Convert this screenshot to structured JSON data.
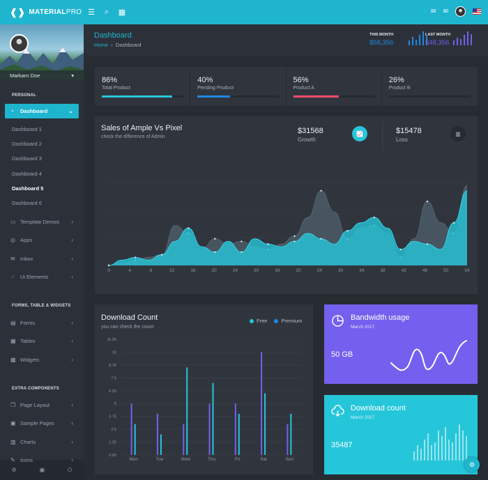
{
  "app": {
    "brand_bold": "MATERIAL",
    "brand_light": "PRO"
  },
  "topbar": {
    "menu_icon": "hamburger-icon",
    "search_icon": "search-icon",
    "grid_icon": "grid-icon",
    "right_icons": [
      "message-icon",
      "mail-icon",
      "user-avatar",
      "us-flag-icon"
    ]
  },
  "sidebar": {
    "user_name": "Markarn Doe",
    "sections": {
      "personal": "PERSONAL",
      "forms": "FORMS, TABLE & WIDGETS",
      "extra": "EXTRA COMPONENTS"
    },
    "dashboard": {
      "label": "Dashboard",
      "icon": "gauge-icon"
    },
    "dashboard_items": [
      "Dashboard 1",
      "Dashboard 2",
      "Dashboard 3",
      "Dashboard 4",
      "Dashboard 5",
      "Dashboard 6"
    ],
    "current_dashboard": "Dashboard 5",
    "menu": [
      {
        "label": "Template Demos",
        "icon": "laptop-icon"
      },
      {
        "label": "Apps",
        "icon": "target-icon"
      },
      {
        "label": "Inbox",
        "icon": "envelope-icon"
      },
      {
        "label": "Ui Elements",
        "icon": "bubbles-icon"
      }
    ],
    "forms_menu": [
      {
        "label": "Forms",
        "icon": "file-icon"
      },
      {
        "label": "Tables",
        "icon": "table-icon"
      },
      {
        "label": "Widgets",
        "icon": "widgets-icon"
      }
    ],
    "extra_menu": [
      {
        "label": "Page Layout",
        "icon": "copy-icon"
      },
      {
        "label": "Sample Pages",
        "icon": "pages-icon"
      },
      {
        "label": "Charts",
        "icon": "file-chart-icon"
      },
      {
        "label": "Icons",
        "icon": "brush-icon"
      }
    ],
    "footer_icons": [
      "settings-icon",
      "inbox-icon",
      "power-icon"
    ]
  },
  "header": {
    "title": "Dashboard",
    "breadcrumb_home": "Home",
    "breadcrumb_current": "Dashboard",
    "this_month": {
      "label": "THIS MONTH",
      "value": "$58,356",
      "bars": [
        4,
        7,
        5,
        9,
        12,
        8
      ]
    },
    "last_month": {
      "label": "LAST MONTH",
      "value": "$48,356",
      "bars": [
        4,
        6,
        5,
        8,
        11,
        9
      ]
    }
  },
  "kpis": [
    {
      "value": "86%",
      "label": "Total Product",
      "percent": 86,
      "color": "#26c6da"
    },
    {
      "value": "40%",
      "label": "Pending Product",
      "percent": 40,
      "color": "#1e88e5"
    },
    {
      "value": "56%",
      "label": "Product A",
      "percent": 56,
      "color": "#fc4b6c"
    },
    {
      "value": "26%",
      "label": "Product B",
      "percent": 0,
      "color": "#7460ee"
    }
  ],
  "sales_chart": {
    "title": "Sales of Ample Vs Pixel",
    "subtitle": "check the difference of Admin",
    "growth_value": "$31568",
    "growth_label": "Growth",
    "growth_icon": "line-chart-icon",
    "loss_value": "$15478",
    "loss_label": "Loss",
    "loss_icon": "bar-chart-icon"
  },
  "download_count": {
    "title": "Download Count",
    "subtitle": "you can check the count",
    "legend_free": "Free",
    "legend_premium": "Premium"
  },
  "bandwidth": {
    "title": "Bandwidth usage",
    "date": "March 2017",
    "value": "50 GB",
    "icon": "pie-chart-icon"
  },
  "download_widget": {
    "title": "Download count",
    "date": "March 2017",
    "value": "35487",
    "icon": "cloud-download-icon",
    "bars": [
      3,
      5,
      4,
      7,
      9,
      5,
      6,
      10,
      8,
      11,
      7,
      6,
      9,
      12,
      10,
      8
    ]
  },
  "fab_icon": "gear-icon",
  "chart_data": [
    {
      "type": "area",
      "x": [
        0,
        2,
        4,
        6,
        8,
        10,
        12,
        14,
        16,
        18,
        20,
        22,
        24,
        26,
        28,
        30,
        32,
        34,
        36,
        38,
        40,
        42,
        44,
        46,
        48,
        50,
        52,
        54
      ],
      "x_ticks": [
        0,
        4,
        8,
        12,
        16,
        20,
        24,
        30,
        16,
        20,
        24,
        30,
        34,
        38,
        42,
        46,
        50,
        54
      ],
      "series": [
        {
          "color": "#4a5a66",
          "values": [
            0,
            1,
            2,
            3,
            4,
            15,
            12,
            6,
            10,
            8,
            9,
            7,
            6,
            8,
            11,
            18,
            28,
            20,
            10,
            14,
            15,
            12,
            3,
            10,
            24,
            16,
            12,
            30
          ]
        },
        {
          "color": "#26c6da",
          "values": [
            0,
            2,
            3,
            2,
            4,
            9,
            14,
            7,
            5,
            9,
            5,
            10,
            8,
            7,
            9,
            12,
            10,
            8,
            13,
            16,
            18,
            14,
            6,
            9,
            8,
            6,
            16,
            28
          ]
        }
      ],
      "ylim": [
        0,
        35
      ]
    },
    {
      "type": "bar",
      "categories": [
        "Mon",
        "Tue",
        "Wed",
        "Thu",
        "Fri",
        "Sat",
        "Sun"
      ],
      "y_ticks": [
        "0.00",
        "1.25",
        "2.5",
        "3.75",
        "5",
        "6.25",
        "7.5",
        "8.75",
        "10",
        "11.25"
      ],
      "ylim": [
        0,
        11.25
      ],
      "series": [
        {
          "name": "Free",
          "color": "#7460ee",
          "values": [
            5,
            4,
            3,
            5,
            5,
            10,
            3
          ]
        },
        {
          "name": "Premium",
          "color": "#26c6da",
          "values": [
            3,
            2,
            8.5,
            7,
            4,
            6,
            4
          ]
        },
        {
          "color": "#7460ee",
          "values": [
            0,
            0,
            0,
            0,
            0,
            0,
            0
          ]
        }
      ]
    }
  ]
}
